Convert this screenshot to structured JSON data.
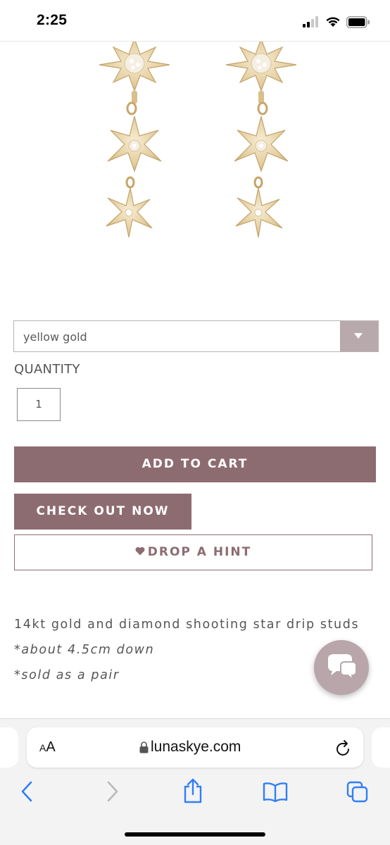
{
  "status_bar": {
    "time": "2:25"
  },
  "product": {
    "variant": {
      "selected": "yellow gold"
    },
    "quantity": {
      "label": "QUANTITY",
      "value": "1"
    },
    "buttons": {
      "add_to_cart": "ADD TO CART",
      "check_out": "CHECK OUT NOW",
      "drop_hint": "DROP A HINT"
    },
    "description": [
      "14kt gold and diamond shooting star drip studs",
      "*about 4.5cm down",
      "*sold as a pair"
    ]
  },
  "browser": {
    "aa_label_small": "A",
    "aa_label_large": "A",
    "url": "lunaskye.com"
  },
  "icons": {
    "chat": "chat-bubbles-icon",
    "back": "chevron-left-icon",
    "forward": "chevron-right-icon",
    "share": "share-icon",
    "bookmarks": "book-icon",
    "tabs": "tabs-icon",
    "lock": "lock-icon",
    "reload": "reload-icon"
  },
  "colors": {
    "brand": "#8d6c71",
    "chat_bubble": "#b8a6aa",
    "select_arrow_bg": "#b8a9ad",
    "safari_blue": "#2f7ff5"
  }
}
